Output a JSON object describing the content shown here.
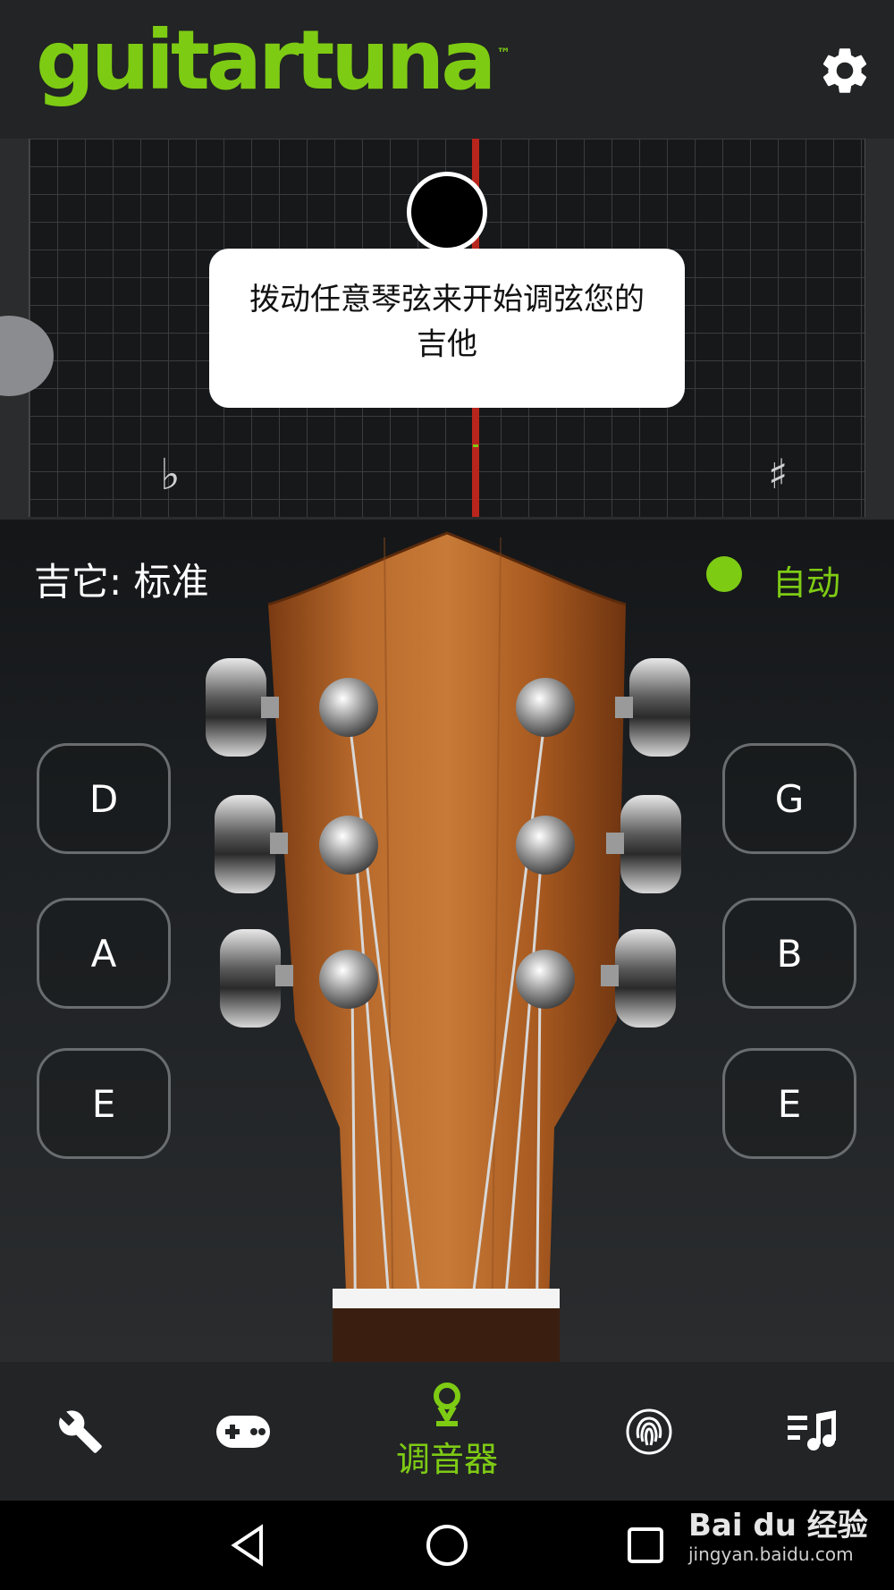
{
  "header": {
    "logo_text": "guitartuna",
    "logo_tm": "™",
    "settings_icon": "gear-icon"
  },
  "tuner": {
    "flat_symbol": "♭",
    "sharp_symbol": "♯",
    "prompt": "拨动任意琴弦来开始调弦您的吉他"
  },
  "tuning": {
    "label": "吉它: 标准",
    "auto_label": "自动",
    "auto_color": "#7ecb14"
  },
  "strings": {
    "left": [
      "D",
      "A",
      "E"
    ],
    "right": [
      "G",
      "B",
      "E"
    ]
  },
  "nav": {
    "items": [
      {
        "icon": "wrench-icon",
        "label": ""
      },
      {
        "icon": "gamepad-icon",
        "label": ""
      },
      {
        "icon": "tuner-pin-icon",
        "label": "调音器"
      },
      {
        "icon": "fingerprint-icon",
        "label": ""
      },
      {
        "icon": "music-list-icon",
        "label": ""
      }
    ],
    "active_color": "#7ecb14"
  },
  "system": {
    "back_icon": "back-triangle-icon",
    "home_icon": "home-circle-icon",
    "recents_icon": "recents-square-icon"
  },
  "watermark": {
    "top": "Bai du 经验",
    "bottom": "jingyan.baidu.com"
  }
}
